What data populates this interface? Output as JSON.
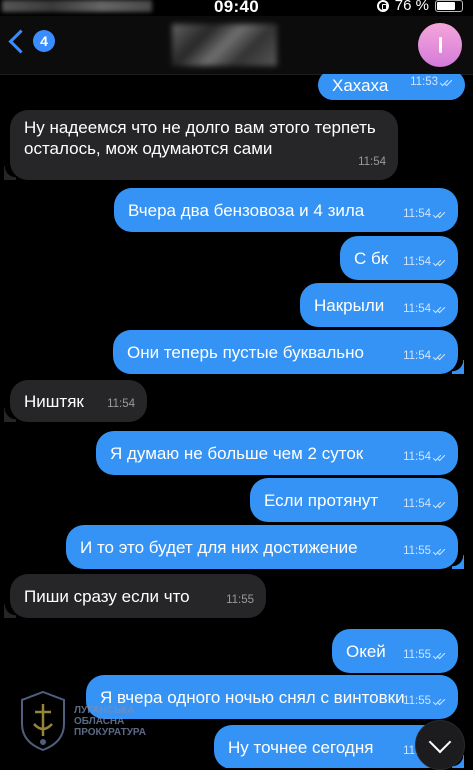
{
  "status_bar": {
    "time": "09:40",
    "battery": "76 %",
    "battery_level": 0.76
  },
  "header": {
    "back_count": "4"
  },
  "messages": [
    {
      "dir": "out",
      "text": "Хахаха",
      "time": "11:53"
    },
    {
      "dir": "in",
      "text": "Ну надеемся что не долго вам этого терпеть осталось, мож одумаются сами",
      "time": "11:54"
    },
    {
      "dir": "out",
      "text": "Вчера два бензовоза и 4 зила",
      "time": "11:54"
    },
    {
      "dir": "out",
      "text": "С бк",
      "time": "11:54"
    },
    {
      "dir": "out",
      "text": "Накрыли",
      "time": "11:54"
    },
    {
      "dir": "out",
      "text": "Они теперь пустые буквально",
      "time": "11:54"
    },
    {
      "dir": "in",
      "text": "Ништяк",
      "time": "11:54"
    },
    {
      "dir": "out",
      "text": "Я думаю не больше чем 2 суток",
      "time": "11:54"
    },
    {
      "dir": "out",
      "text": "Если протянут",
      "time": "11:54"
    },
    {
      "dir": "out",
      "text": "И то это будет для них достижение",
      "time": "11:55"
    },
    {
      "dir": "in",
      "text": "Пиши сразу если что",
      "time": "11:55"
    },
    {
      "dir": "out",
      "text": "Окей",
      "time": "11:55"
    },
    {
      "dir": "out",
      "text": "Я вчера одного ночью снял с винтовки",
      "time": "11:55"
    },
    {
      "dir": "out",
      "text": "Ну точнее сегодня",
      "time": "11:55"
    }
  ],
  "watermark": {
    "line1": "Луганська",
    "line2": "обласна",
    "line3": "прокуратура"
  },
  "icons": {
    "back": "chevron-left-icon",
    "scroll": "chevron-down-icon",
    "read": "double-check-icon"
  },
  "colors": {
    "outgoing": "#3493f5",
    "incoming": "#262628",
    "accent": "#3a8dff"
  }
}
